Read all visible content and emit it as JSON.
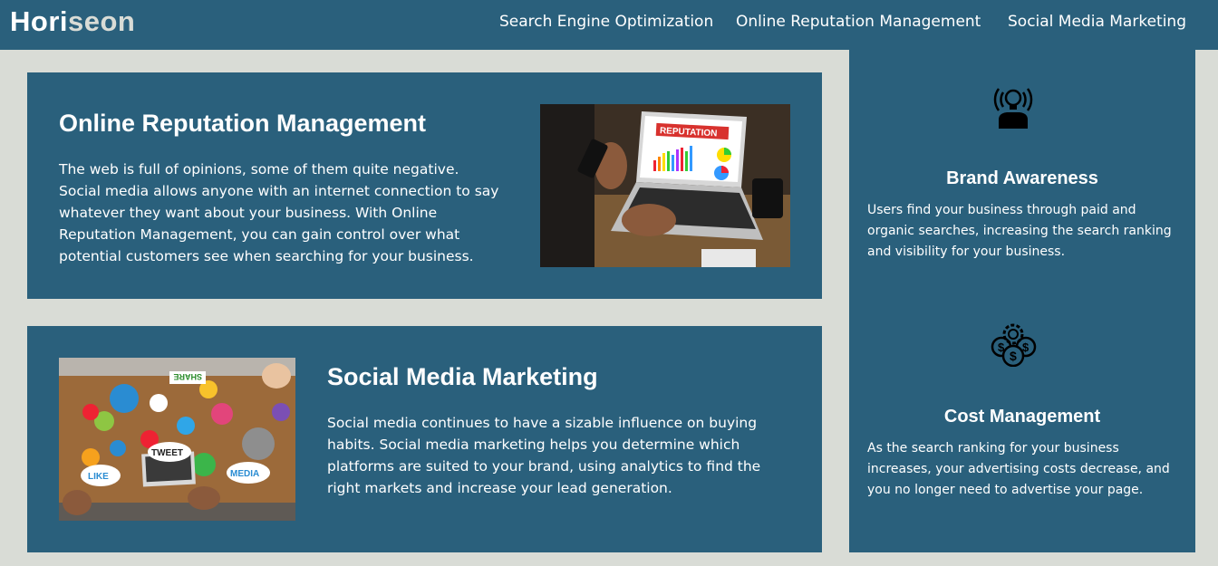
{
  "header": {
    "logo_main": "Hori",
    "logo_accent": "seon",
    "nav": [
      "Search Engine Optimization",
      "Online Reputation Management",
      "Social Media Marketing"
    ]
  },
  "main": {
    "cards": [
      {
        "title": "Online Reputation Management",
        "text": "The web is full of opinions, some of them quite negative. Social media allows anyone with an internet connection to say whatever they want about your business. With Online Reputation Management, you can gain control over what potential customers see when searching for your business.",
        "image_label": "REPUTATION"
      },
      {
        "title": "Social Media Marketing",
        "text": "Social media continues to have a sizable influence on buying habits. Social media marketing helps you determine which platforms are suited to your brand, using analytics to find the right markets and increase your lead generation.",
        "image_labels": [
          "SHARE",
          "TWEET",
          "LIKE",
          "MEDIA"
        ]
      }
    ]
  },
  "benefits": [
    {
      "icon": "lightbulb-person-icon",
      "title": "Brand Awareness",
      "text": "Users find your business through paid and organic searches, increasing the search ranking and visibility for your business."
    },
    {
      "icon": "gear-dollar-icon",
      "title": "Cost Management",
      "text": "As the search ranking for your business increases, your advertising costs decrease, and you no longer need to advertise your page."
    }
  ],
  "colors": {
    "primary": "#2a607c",
    "background": "#d9dcd6",
    "accent": "#d9dcd6"
  }
}
